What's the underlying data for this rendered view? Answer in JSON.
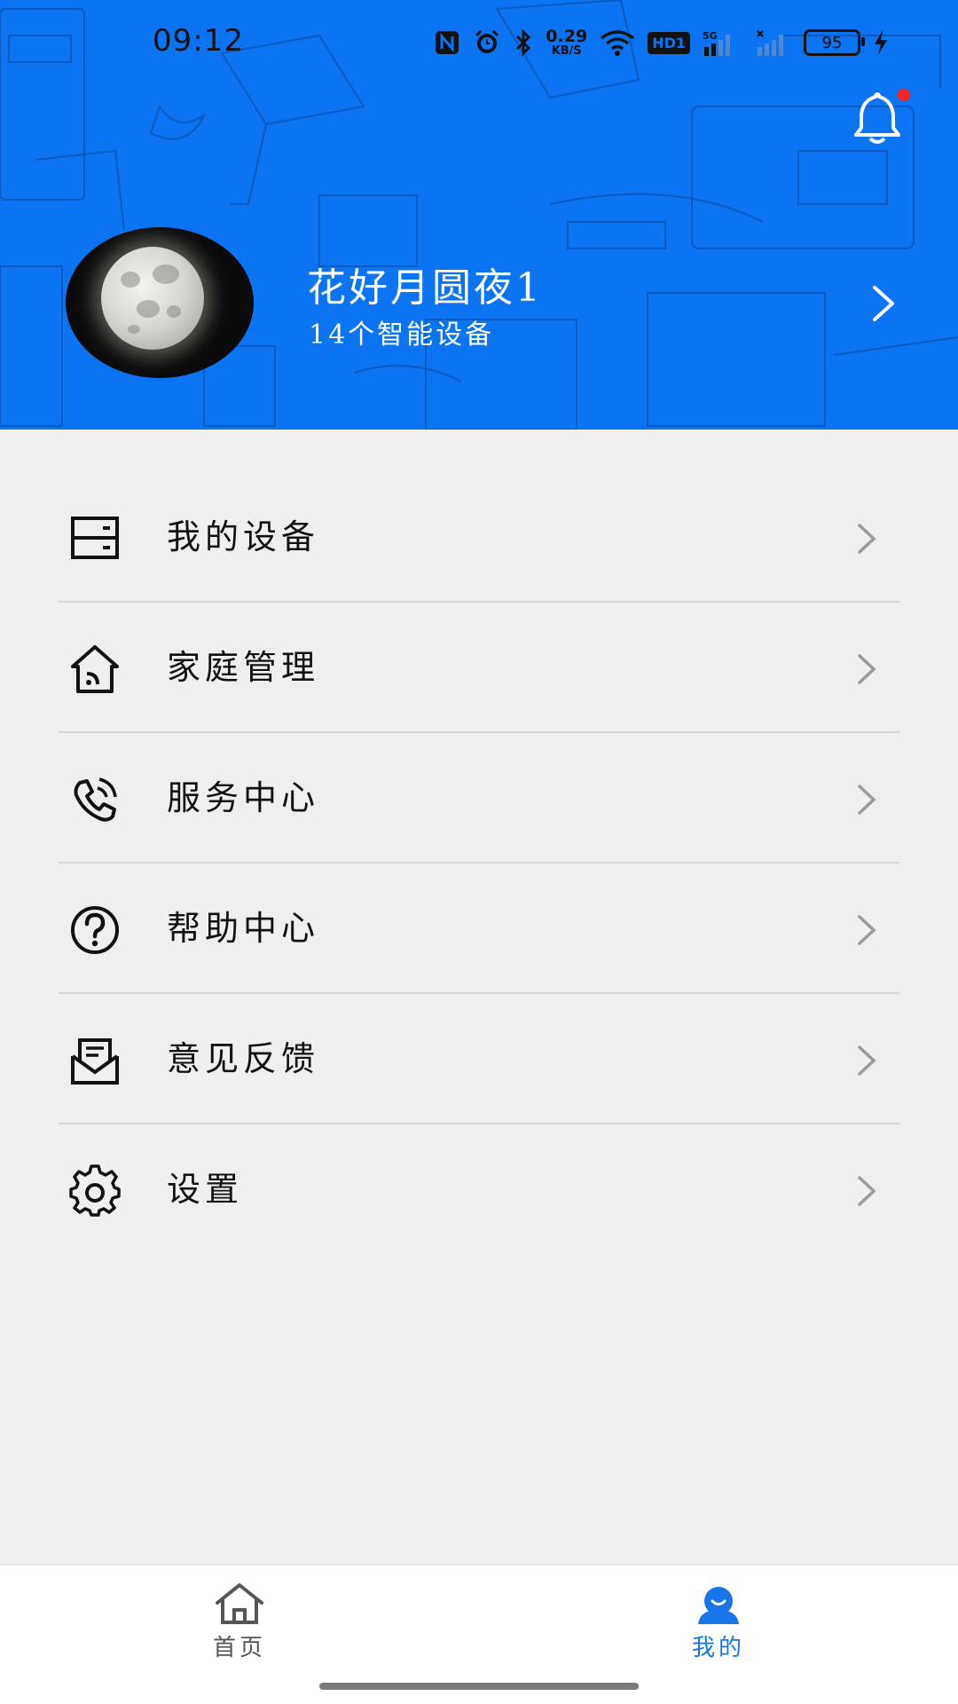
{
  "status_bar": {
    "time": "09:12",
    "net_speed": "0.29",
    "net_unit": "KB/S",
    "hd": "HD1",
    "signal": "5G",
    "battery": "95"
  },
  "profile": {
    "name": "花好月圆夜1",
    "device_count": "14个智能设备"
  },
  "menu": {
    "items": [
      {
        "label": "我的设备",
        "icon": "devices-icon"
      },
      {
        "label": "家庭管理",
        "icon": "home-manage-icon"
      },
      {
        "label": "服务中心",
        "icon": "phone-service-icon"
      },
      {
        "label": "帮助中心",
        "icon": "help-icon"
      },
      {
        "label": "意见反馈",
        "icon": "feedback-mail-icon"
      },
      {
        "label": "设置",
        "icon": "gear-icon"
      }
    ]
  },
  "bottom_nav": {
    "tabs": [
      {
        "label": "首页",
        "icon": "home-icon",
        "active": false
      },
      {
        "label": "我的",
        "icon": "user-icon",
        "active": true
      }
    ]
  },
  "colors": {
    "brand_blue": "#0a74f2",
    "active_tab": "#1a73e8",
    "background": "#efefef",
    "notification_dot": "#ff2020"
  }
}
